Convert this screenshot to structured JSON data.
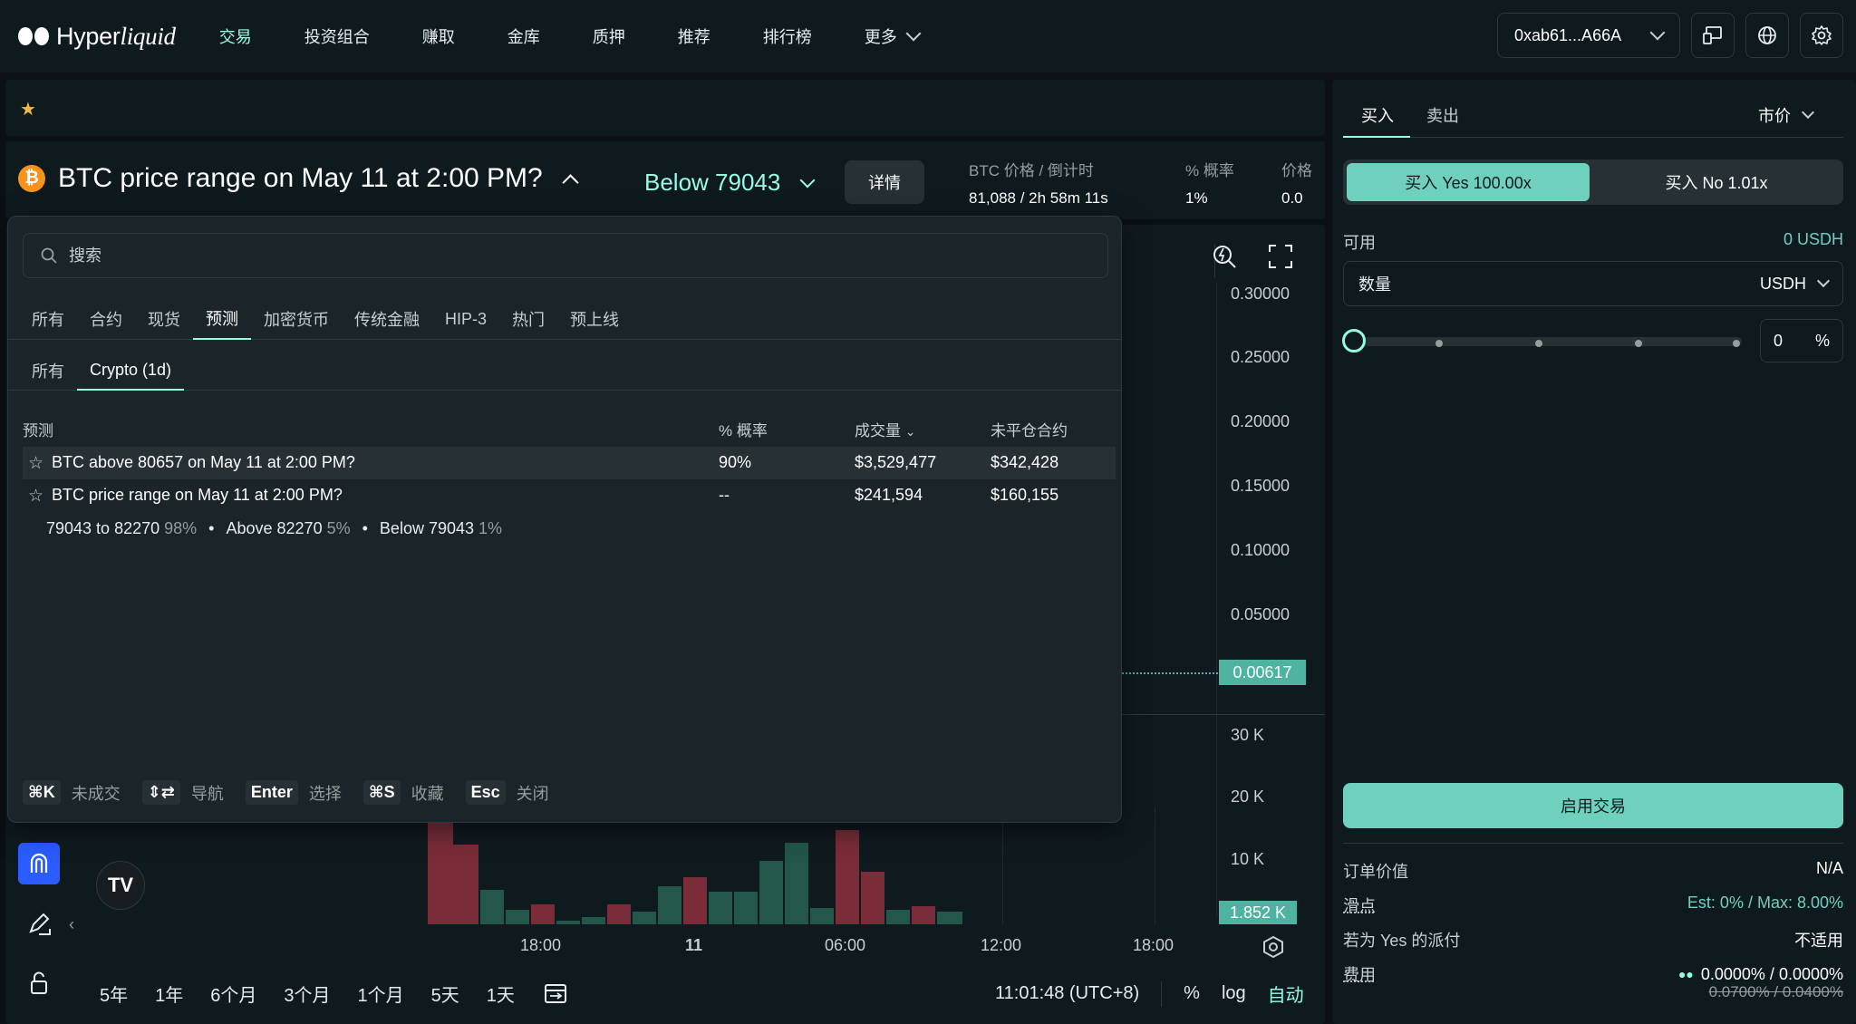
{
  "app": {
    "logo_text_plain": "Hyper",
    "logo_text_italic": "liquid"
  },
  "nav": {
    "items": [
      {
        "label": "交易",
        "active": true
      },
      {
        "label": "投资组合"
      },
      {
        "label": "赚取"
      },
      {
        "label": "金库"
      },
      {
        "label": "质押"
      },
      {
        "label": "推荐"
      },
      {
        "label": "排行榜"
      }
    ],
    "more_label": "更多"
  },
  "wallet": {
    "address": "0xab61...A66A"
  },
  "market": {
    "name": "BTC price range on May 11 at 2:00 PM?",
    "outcome": "Below 79043",
    "details_label": "详情",
    "stats": [
      {
        "label": "BTC 价格 / 倒计时",
        "value": "81,088 / 2h 58m 11s"
      },
      {
        "label": "% 概率",
        "value": "1%"
      },
      {
        "label": "价格",
        "value": "0.0"
      }
    ]
  },
  "selector": {
    "search_placeholder": "搜索",
    "tabs": [
      "所有",
      "合约",
      "现货",
      "预测",
      "加密货币",
      "传统金融",
      "HIP-3",
      "热门",
      "预上线"
    ],
    "active_tab": 3,
    "subtabs": [
      "所有",
      "Crypto (1d)"
    ],
    "active_subtab": 1,
    "columns": [
      "预测",
      "% 概率",
      "成交量",
      "未平仓合约"
    ],
    "rows": [
      {
        "name": "BTC above 80657 on May 11 at 2:00 PM?",
        "prob": "90%",
        "volume": "$3,529,477",
        "oi": "$342,428"
      },
      {
        "name": "BTC price range on May 11 at 2:00 PM?",
        "prob": "--",
        "volume": "$241,594",
        "oi": "$160,155"
      }
    ],
    "outcomes": [
      {
        "label": "79043 to 82270",
        "pct": "98%"
      },
      {
        "label": "Above 82270",
        "pct": "5%"
      },
      {
        "label": "Below 79043",
        "pct": "1%"
      }
    ],
    "shortcuts": [
      {
        "key": "⌘K",
        "desc": "未成交"
      },
      {
        "key": "⇕⇄",
        "desc": "导航"
      },
      {
        "key": "Enter",
        "desc": "选择"
      },
      {
        "key": "⌘S",
        "desc": "收藏"
      },
      {
        "key": "Esc",
        "desc": "关闭"
      }
    ]
  },
  "chart": {
    "y_labels": [
      "0.30000",
      "0.25000",
      "0.20000",
      "0.15000",
      "0.10000",
      "0.05000"
    ],
    "price_tag": "0.00617",
    "vol_labels": [
      "30 K",
      "20 K",
      "10 K"
    ],
    "vol_tag": "1.852 K",
    "x_labels": [
      "18:00",
      "11",
      "06:00",
      "12:00",
      "18:00"
    ],
    "timeframes": [
      "5年",
      "1年",
      "6个月",
      "3个月",
      "1个月",
      "5天",
      "1天"
    ],
    "time": "11:01:48 (UTC+8)",
    "pct_label": "%",
    "log_label": "log",
    "auto_label": "自动"
  },
  "order": {
    "buy_tab": "买入",
    "sell_tab": "卖出",
    "order_type": "市价",
    "yes_label": "买入 Yes 100.00x",
    "no_label": "买入 No 1.01x",
    "available_label": "可用",
    "available_value": "0 USDH",
    "qty_label": "数量",
    "qty_unit": "USDH",
    "pct_value": "0",
    "pct_sign": "%",
    "enable_label": "启用交易",
    "info": [
      {
        "k": "订单价值",
        "v": "N/A"
      },
      {
        "k": "滑点",
        "v": "Est: 0% / Max: 8.00%"
      },
      {
        "k": "若为 Yes 的派付",
        "v": "不适用"
      },
      {
        "k": "费用",
        "v": "0.0000% / 0.0000%"
      }
    ],
    "fee_original": "0.0700% / 0.0400%"
  },
  "colors": {
    "accent": "#97fce4",
    "button": "#6fd0bd",
    "up": "#22574a",
    "down": "#7a2d38",
    "bg": "#0f1a1f"
  }
}
